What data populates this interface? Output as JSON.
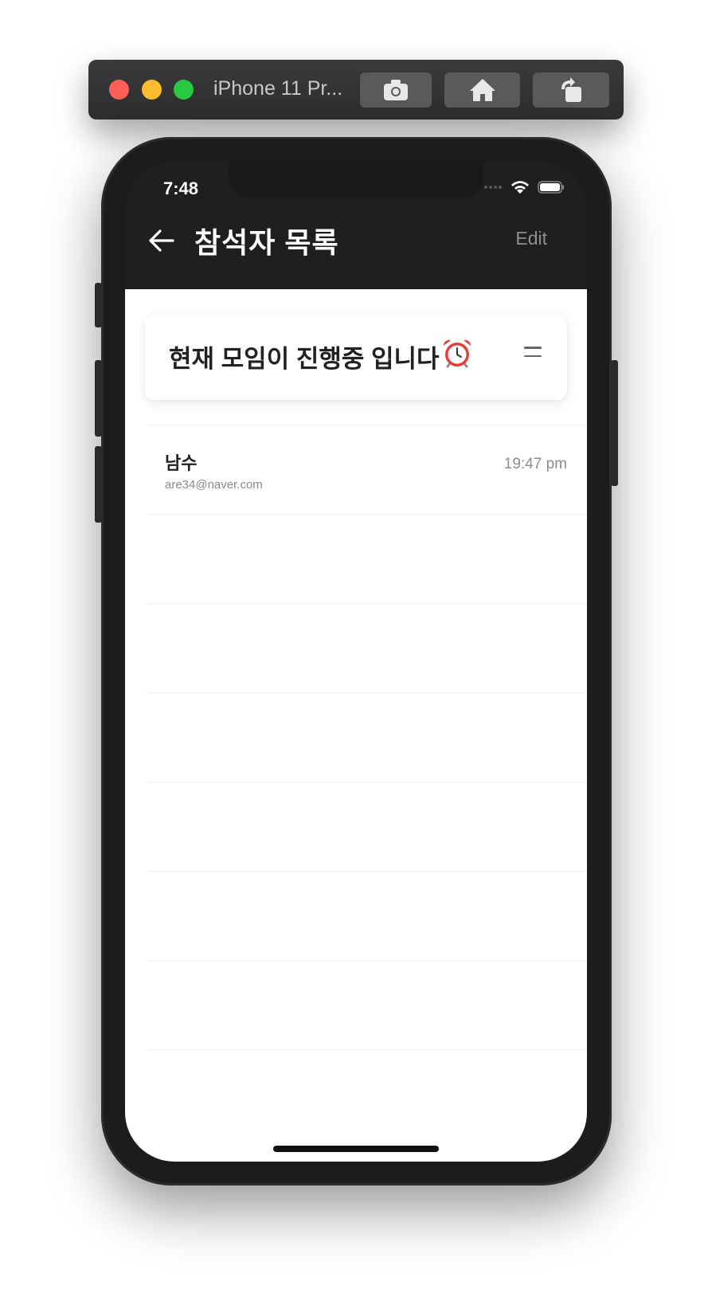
{
  "simulator": {
    "title": "iPhone 11 Pr...",
    "buttons": [
      "screenshot",
      "home",
      "rotate"
    ]
  },
  "status_bar": {
    "time": "7:48"
  },
  "header": {
    "title": "참석자 목록",
    "edit_label": "Edit"
  },
  "banner": {
    "text": "현재 모임이 진행중 입니다",
    "emoji_icon": "alarm-clock-icon"
  },
  "attendees": [
    {
      "name": "남수",
      "email": "are34@naver.com",
      "time": "19:47 pm"
    },
    {
      "name": "",
      "email": "",
      "time": ""
    },
    {
      "name": "",
      "email": "",
      "time": ""
    },
    {
      "name": "",
      "email": "",
      "time": ""
    },
    {
      "name": "",
      "email": "",
      "time": ""
    },
    {
      "name": "",
      "email": "",
      "time": ""
    },
    {
      "name": "",
      "email": "",
      "time": ""
    }
  ],
  "colors": {
    "header_bg": "#1f1f1f",
    "content_bg": "#ffffff",
    "edit_text": "#8e8e8e"
  }
}
